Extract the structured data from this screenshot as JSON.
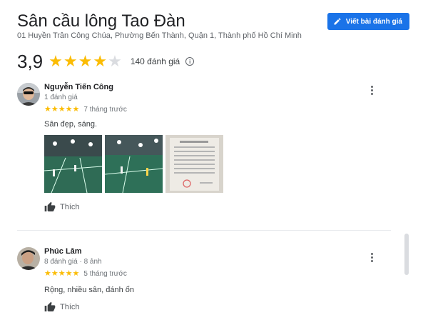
{
  "place": {
    "title": "Sân cầu lông Tao Đàn",
    "address": "01 Huyền Trân Công Chúa, Phường Bến Thành, Quận 1, Thành phố Hồ Chí Minh"
  },
  "header": {
    "write_review_label": "Viết bài đánh giá",
    "accent_color": "#1a73e8"
  },
  "rating": {
    "value": "3,9",
    "stars_filled": 4,
    "stars_total": 5,
    "review_count": "140 đánh giá",
    "info_icon": "info-icon"
  },
  "reviews": [
    {
      "name": "Nguyễn Tiến Công",
      "meta": "1 đánh giá",
      "stars": 5,
      "time": "7 tháng trước",
      "text": "Sân đẹp, sáng.",
      "photo_count": 3,
      "like_label": "Thích"
    },
    {
      "name": "Phúc Lâm",
      "meta": "8 đánh giá · 8 ảnh",
      "stars": 5,
      "time": "5 tháng trước",
      "text": "Rộng, nhiều sân, đánh ổn",
      "like_label": "Thích"
    }
  ],
  "icons": {
    "write": "pencil-icon",
    "more": "more-vert-icon",
    "like": "thumb-up-icon",
    "star": "star-icon"
  },
  "colors": {
    "star_on": "#fbbc04",
    "star_off": "#dadce0"
  }
}
